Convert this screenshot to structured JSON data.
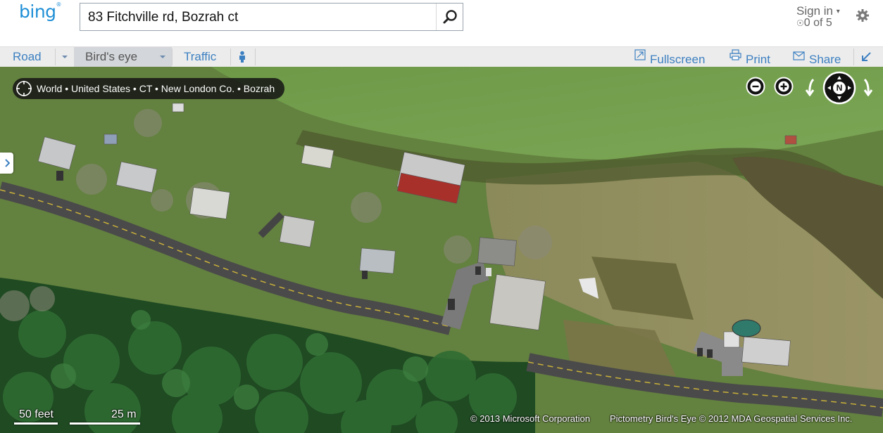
{
  "header": {
    "logo": "bing",
    "search": {
      "value": "83 Fitchville rd, Bozrah ct",
      "placeholder": ""
    },
    "signin_label": "Sign in",
    "rewards_label": "0 of 5"
  },
  "toolbar": {
    "road_label": "Road",
    "birdseye_label": "Bird's eye",
    "traffic_label": "Traffic",
    "fullscreen_label": "Fullscreen",
    "print_label": "Print",
    "share_label": "Share"
  },
  "map": {
    "breadcrumb": "World • United States • CT • New London Co. • Bozrah",
    "compass_label": "N",
    "scale": {
      "feet": "50 feet",
      "meters": "25 m"
    },
    "copyright_ms": "© 2013 Microsoft Corporation",
    "copyright_pictometry": "Pictometry Bird's Eye © 2012 MDA Geospatial Services Inc."
  },
  "icons": {
    "search": "search-icon",
    "gear": "gear-icon",
    "locate": "locate-icon",
    "zoom_out": "zoom-out-icon",
    "zoom_in": "zoom-in-icon",
    "rotate_left": "rotate-left-icon",
    "rotate_right": "rotate-right-icon",
    "compass": "compass-icon"
  },
  "colors": {
    "brand": "#1f8fd6",
    "link": "#3d80c1",
    "toolbar_bg": "#ececec"
  }
}
